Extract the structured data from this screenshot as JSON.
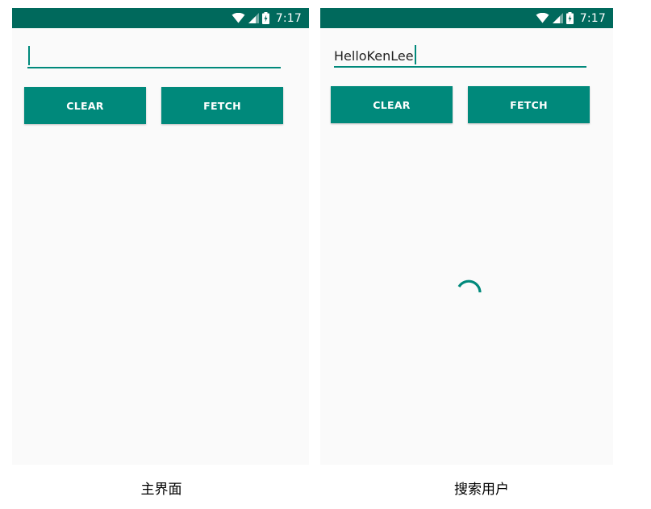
{
  "screens": [
    {
      "status_bar": {
        "time": "7:17"
      },
      "text_field": {
        "value": ""
      },
      "buttons": {
        "clear_label": "CLEAR",
        "fetch_label": "FETCH"
      },
      "caption": "主界面"
    },
    {
      "status_bar": {
        "time": "7:17"
      },
      "text_field": {
        "value": "HelloKenLee"
      },
      "buttons": {
        "clear_label": "CLEAR",
        "fetch_label": "FETCH"
      },
      "loading_indicator": {
        "icon": "spinner-icon"
      },
      "caption": "搜索用户"
    }
  ],
  "colors": {
    "status_bar": "#00695c",
    "accent": "#00897b",
    "screen_background": "#fafafa"
  }
}
